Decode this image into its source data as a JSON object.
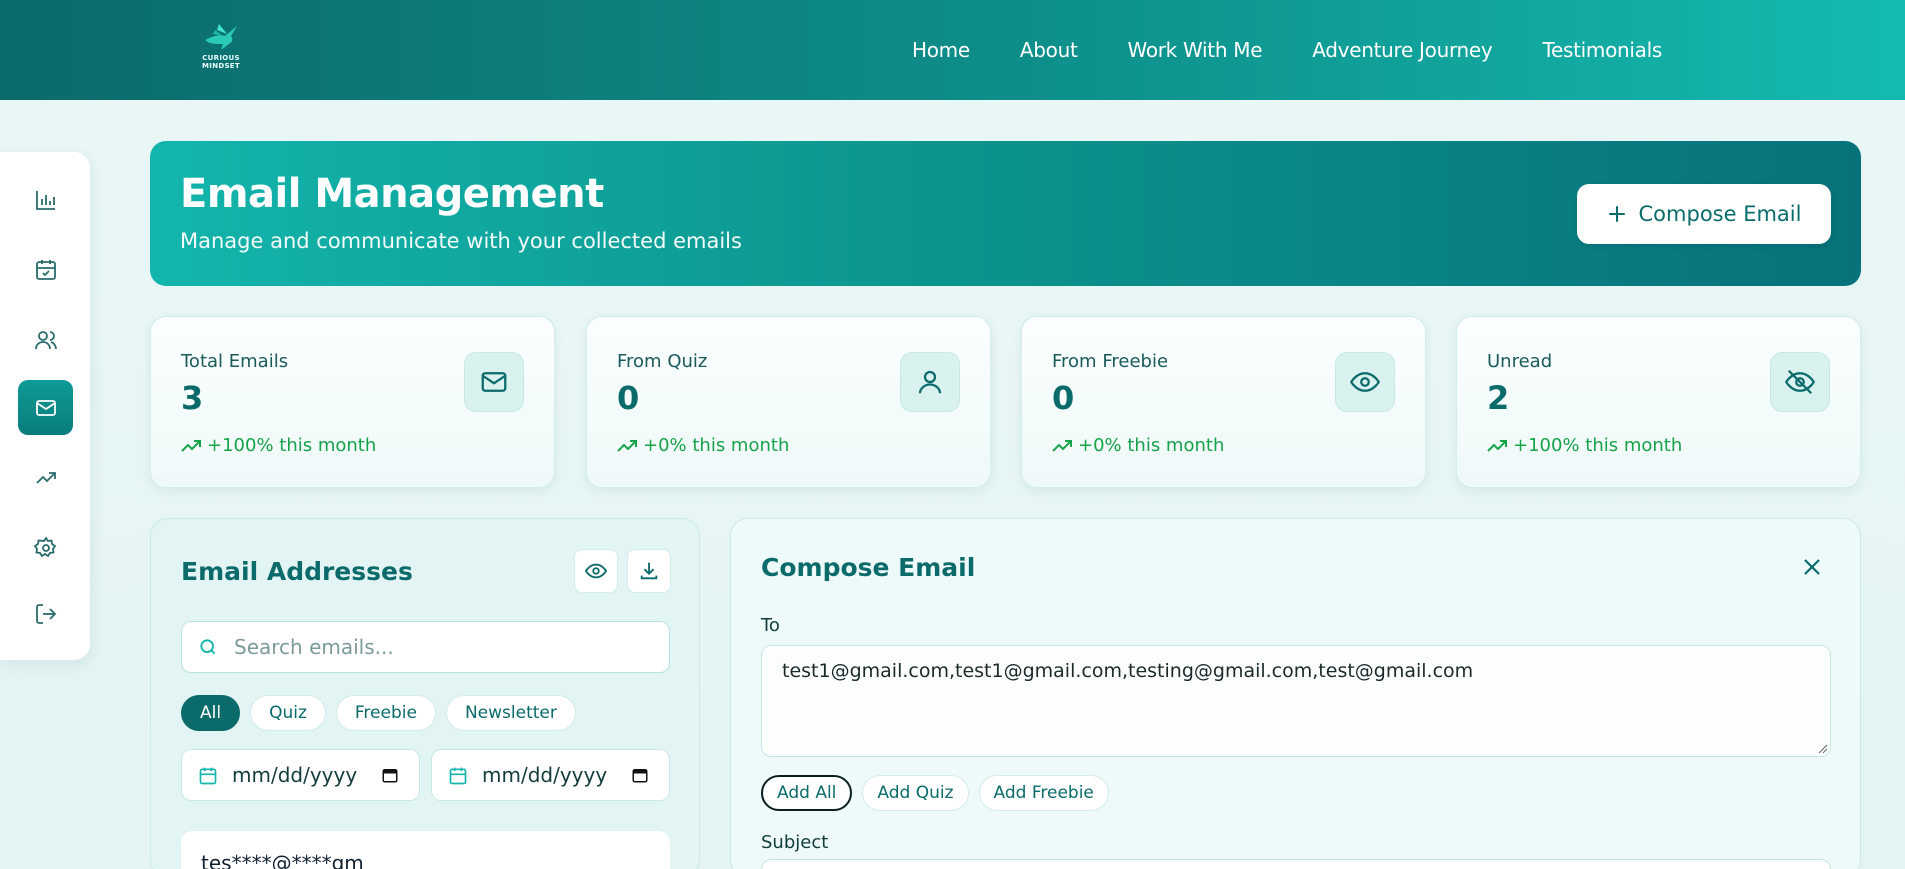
{
  "logo": {
    "text": "CURIOUS MINDSET",
    "alt": "curious-mindset-logo"
  },
  "nav": [
    "Home",
    "About",
    "Work With Me",
    "Adventure Journey",
    "Testimonials"
  ],
  "sidebar": {
    "items": [
      {
        "icon": "bar-chart-icon",
        "active": false
      },
      {
        "icon": "calendar-check-icon",
        "active": false
      },
      {
        "icon": "users-icon",
        "active": false
      },
      {
        "icon": "mail-icon",
        "active": true
      },
      {
        "icon": "trending-up-icon",
        "active": false
      },
      {
        "icon": "gear-icon",
        "active": false
      },
      {
        "icon": "logout-icon",
        "active": false
      }
    ]
  },
  "hero": {
    "title": "Email Management",
    "subtitle": "Manage and communicate with your collected emails",
    "compose_label": "Compose Email"
  },
  "stats": [
    {
      "label": "Total Emails",
      "value": "3",
      "trend": "+100% this month",
      "icon": "mail-icon"
    },
    {
      "label": "From Quiz",
      "value": "0",
      "trend": "+0% this month",
      "icon": "user-icon"
    },
    {
      "label": "From Freebie",
      "value": "0",
      "trend": "+0% this month",
      "icon": "eye-icon"
    },
    {
      "label": "Unread",
      "value": "2",
      "trend": "+100% this month",
      "icon": "eye-off-icon"
    }
  ],
  "addresses": {
    "title": "Email Addresses",
    "search_placeholder": "Search emails...",
    "filters": [
      "All",
      "Quiz",
      "Freebie",
      "Newsletter"
    ],
    "active_filter": "All",
    "date_from": "mm/dd/yyyy",
    "date_to": "mm/dd/yyyy",
    "first_email": "tes****@****gm"
  },
  "compose": {
    "title": "Compose Email",
    "to_label": "To",
    "to_value": "test1@gmail.com,test1@gmail.com,testing@gmail.com,test@gmail.com",
    "add_buttons": [
      "Add All",
      "Add Quiz",
      "Add Freebie"
    ],
    "subject_label": "Subject"
  },
  "colors": {
    "primary": "#0b6a6a",
    "accent": "#13b5ac",
    "trend": "#16a34a"
  }
}
